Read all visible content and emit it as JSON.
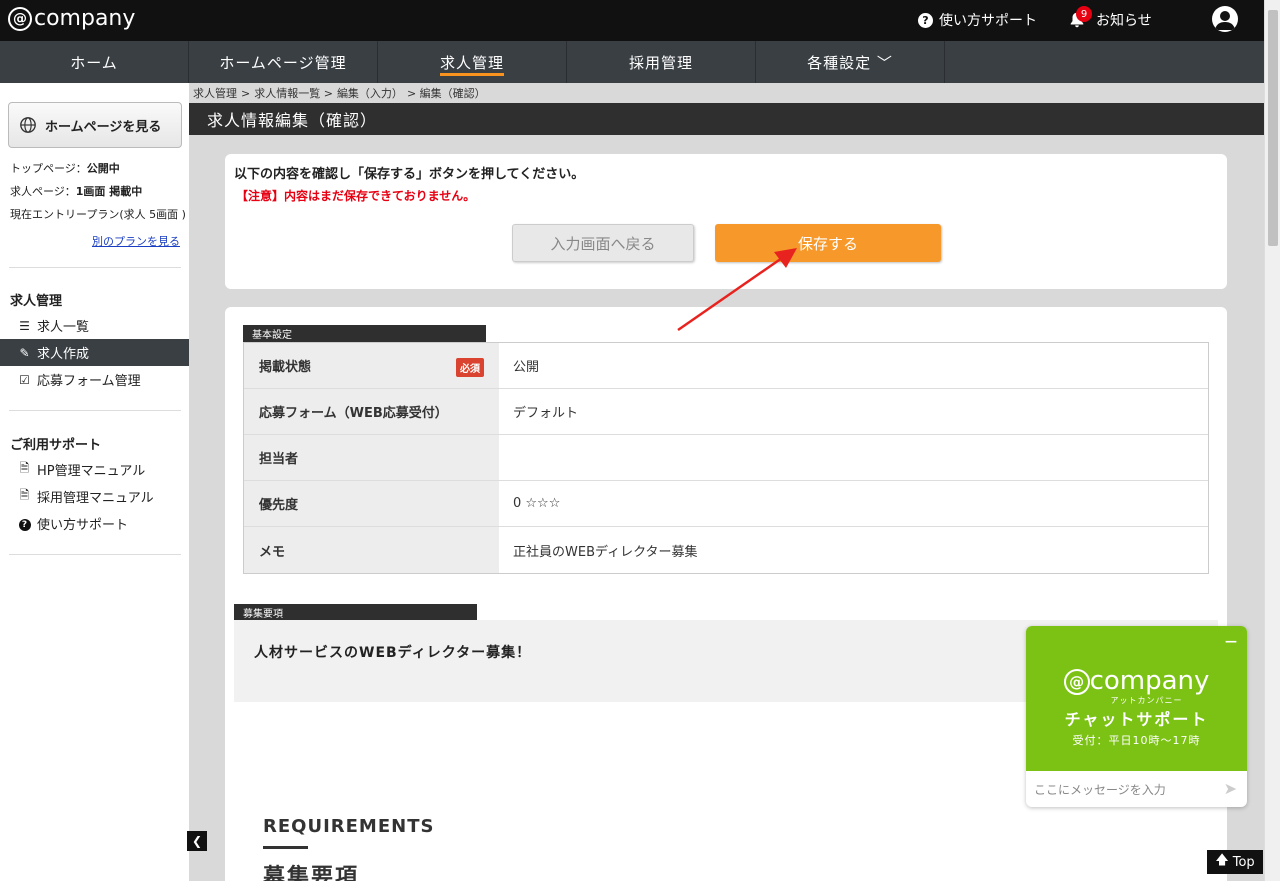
{
  "header": {
    "logo": "company",
    "logo_at": "@",
    "support_label": "使い方サポート",
    "notice_label": "お知らせ",
    "notice_count": "9"
  },
  "nav": {
    "items": [
      {
        "label": "ホーム"
      },
      {
        "label": "ホームページ管理"
      },
      {
        "label": "求人管理"
      },
      {
        "label": "採用管理"
      },
      {
        "label": "各種設定 ﹀"
      }
    ]
  },
  "sidebar": {
    "hp_button": "ホームページを見る",
    "top_page": "トップページ：",
    "top_page_status": "公開中",
    "job_page": "求人ページ：",
    "job_page_status": "1画面 掲載中",
    "plan": "現在エントリープラン(求人 5画面 )",
    "other_plan_link": "別のプランを見る",
    "section1_title": "求人管理",
    "section1_items": [
      {
        "label": "求人一覧",
        "icon": "list-icon"
      },
      {
        "label": "求人作成",
        "icon": "edit-icon"
      },
      {
        "label": "応募フォーム管理",
        "icon": "checkbox-icon"
      }
    ],
    "section2_title": "ご利用サポート",
    "section2_items": [
      {
        "label": "HP管理マニュアル",
        "icon": "pdf-icon"
      },
      {
        "label": "採用管理マニュアル",
        "icon": "pdf-icon"
      },
      {
        "label": "使い方サポート",
        "icon": "question-icon"
      }
    ]
  },
  "breadcrumb": {
    "items": [
      "求人管理",
      ">",
      "求人情報一覧 >",
      "編集（入力）",
      "> 編集（確認）"
    ]
  },
  "page": {
    "title": "求人情報編集（確認）",
    "confirm_message": "以下の内容を確認し「保存する」ボタンを押してください。",
    "warning": "【注意】内容はまだ保存できておりません。",
    "back_button": "入力画面へ戻る",
    "save_button": "保存する"
  },
  "basic": {
    "section_label": "基本設定",
    "required_tag": "必須",
    "rows": [
      {
        "label": "掲載状態",
        "value": "公開"
      },
      {
        "label": "応募フォーム（WEB応募受付）",
        "value": "デフォルト"
      },
      {
        "label": "担当者",
        "value": ""
      },
      {
        "label": "優先度",
        "value": "0 ☆☆☆"
      },
      {
        "label": "メモ",
        "value": "正社員のWEBディレクター募集"
      }
    ]
  },
  "recruit": {
    "section_label": "募集要項",
    "text": "人材サービスのWEBディレクター募集！",
    "heading_en": "REQUIREMENTS",
    "heading_jp": "募集要項"
  },
  "chat": {
    "minimize": "—",
    "logo": "company",
    "logo_at": "@",
    "kana": "アットカンパニー",
    "title": "チャットサポート",
    "hours": "受付：平日10時〜17時",
    "placeholder": "ここにメッセージを入力"
  },
  "footer": {
    "collapse": "❮",
    "top_label": "Top"
  },
  "colors": {
    "accent": "#f7992a",
    "chat_green": "#7cc215",
    "warning_red": "#e60012",
    "header_dark": "#111111",
    "nav_dark": "#3a3f44"
  }
}
